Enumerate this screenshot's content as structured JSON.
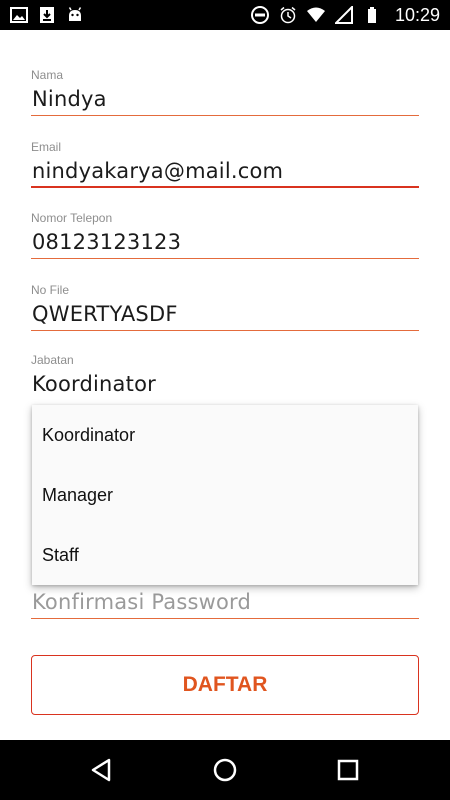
{
  "status_bar": {
    "time": "10:29",
    "left_icons": [
      "image-icon",
      "download-icon",
      "android-icon"
    ],
    "right_icons": [
      "dnd-icon",
      "alarm-icon",
      "wifi-icon",
      "signal-icon",
      "battery-icon"
    ]
  },
  "form": {
    "fields": [
      {
        "label": "Nama",
        "value": "Nindya"
      },
      {
        "label": "Email",
        "value": "nindyakarya@mail.com"
      },
      {
        "label": "Nomor Telepon",
        "value": "08123123123"
      },
      {
        "label": "No File",
        "value": "QWERTYASDF"
      },
      {
        "label": "Jabatan",
        "value": "Koordinator"
      }
    ],
    "confirm_password_placeholder": "Konfirmasi Password",
    "submit_label": "DAFTAR"
  },
  "dropdown": {
    "options": [
      "Koordinator",
      "Manager",
      "Staff"
    ]
  },
  "nav_bar": {
    "buttons": [
      "back-icon",
      "home-icon",
      "recents-icon"
    ]
  },
  "colors": {
    "accent": "#e0551f",
    "underline": "#e46b3c",
    "active_underline": "#d9331f",
    "label": "#8e8e8e"
  }
}
